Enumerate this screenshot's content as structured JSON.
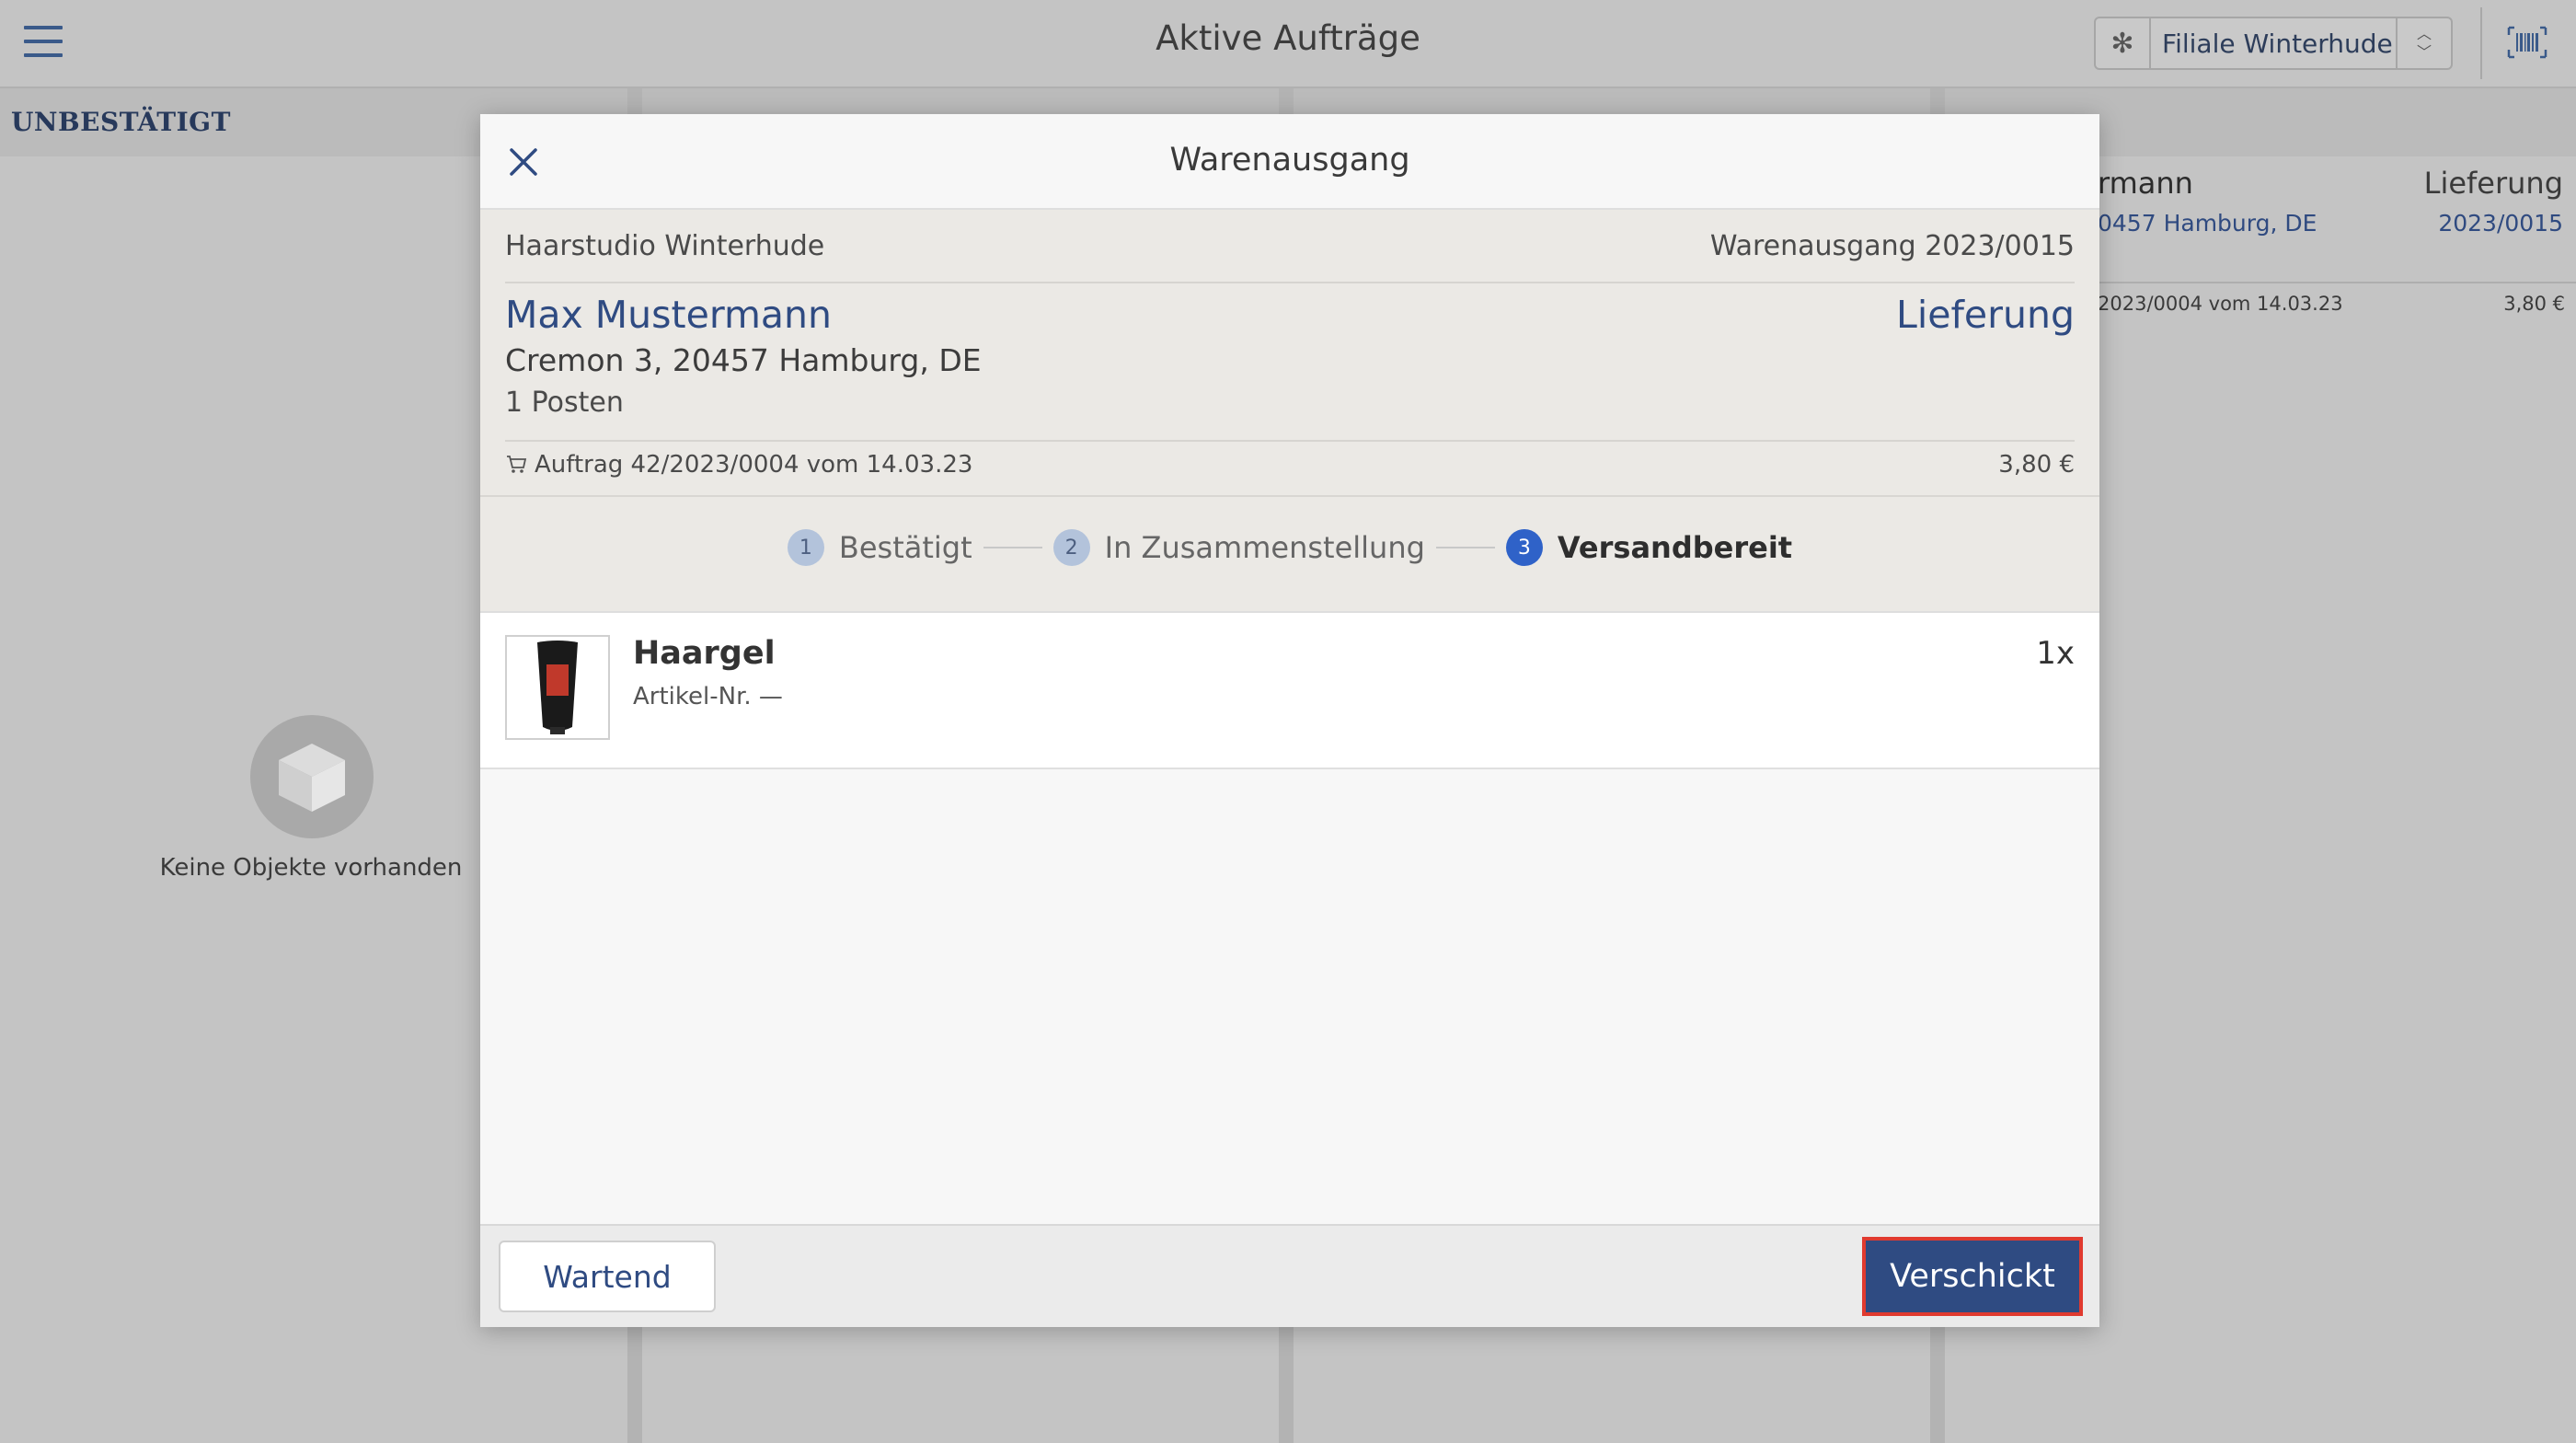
{
  "app": {
    "title": "Aktive Aufträge",
    "branch": "Filiale Winterhude"
  },
  "columns": {
    "unconfirmed": "UNBESTÄTIGT",
    "empty_text": "Keine Objekte vorhanden"
  },
  "bg_card": {
    "name": "rmann",
    "address": "0457 Hamburg, DE",
    "type": "Lieferung",
    "number": "2023/0015",
    "order": "2023/0004 vom 14.03.23",
    "price": "3,80 €"
  },
  "modal": {
    "title": "Warenausgang",
    "shop": "Haarstudio Winterhude",
    "document": "Warenausgang 2023/0015",
    "customer_name": "Max Mustermann",
    "delivery_type": "Lieferung",
    "address": "Cremon 3, 20457 Hamburg, DE",
    "item_count": "1 Posten",
    "order": "Auftrag 42/2023/0004 vom 14.03.23",
    "order_price": "3,80 €",
    "steps": [
      {
        "num": "1",
        "label": "Bestätigt"
      },
      {
        "num": "2",
        "label": "In Zusammenstellung"
      },
      {
        "num": "3",
        "label": "Versandbereit"
      }
    ],
    "items": [
      {
        "name": "Haargel",
        "sku": "Artikel-Nr. —",
        "qty": "1x"
      }
    ],
    "buttons": {
      "wait": "Wartend",
      "sent": "Verschickt"
    }
  },
  "colors": {
    "accent": "#2f4b82",
    "step_active": "#2f62c8",
    "highlight": "#e03a2f"
  }
}
